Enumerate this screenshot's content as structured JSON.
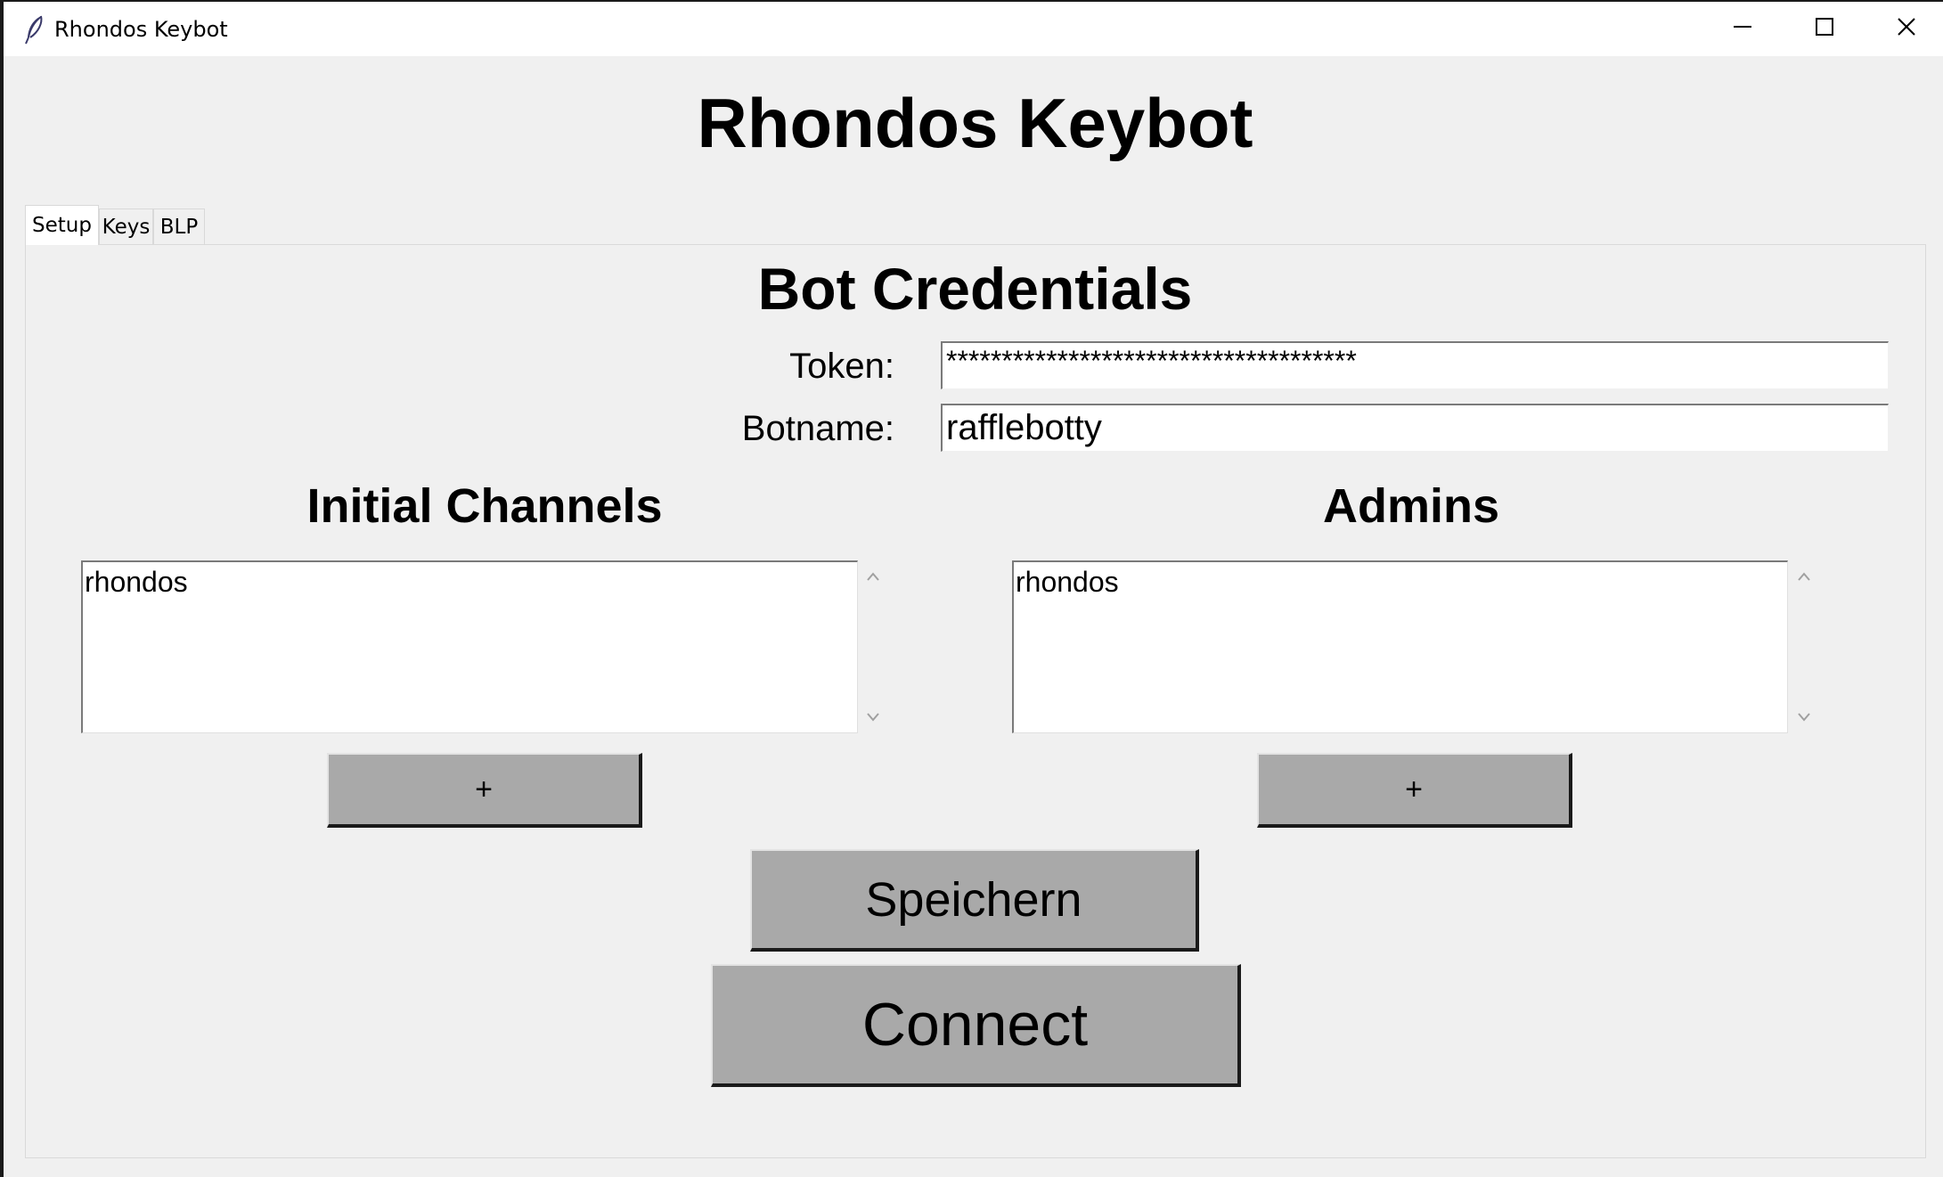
{
  "window": {
    "title": "Rhondos Keybot",
    "icon": "feather-icon",
    "controls": {
      "minimize_icon": "minimize-icon",
      "maximize_icon": "maximize-icon",
      "close_icon": "close-icon"
    }
  },
  "header": {
    "title": "Rhondos Keybot"
  },
  "tabs": [
    {
      "label": "Setup",
      "active": true
    },
    {
      "label": "Keys",
      "active": false
    },
    {
      "label": "BLP",
      "active": false
    }
  ],
  "setup": {
    "credentials_title": "Bot Credentials",
    "token_label": "Token:",
    "token_value": "*************************************",
    "botname_label": "Botname:",
    "botname_value": "rafflebotty",
    "channels": {
      "title": "Initial Channels",
      "items": [
        "rhondos"
      ],
      "add_label": "+"
    },
    "admins": {
      "title": "Admins",
      "items": [
        "rhondos"
      ],
      "add_label": "+"
    },
    "save_label": "Speichern",
    "connect_label": "Connect"
  },
  "colors": {
    "window_bg": "#f0f0f0",
    "button_bg": "#a9a9a9",
    "entry_bg": "#ffffff"
  }
}
